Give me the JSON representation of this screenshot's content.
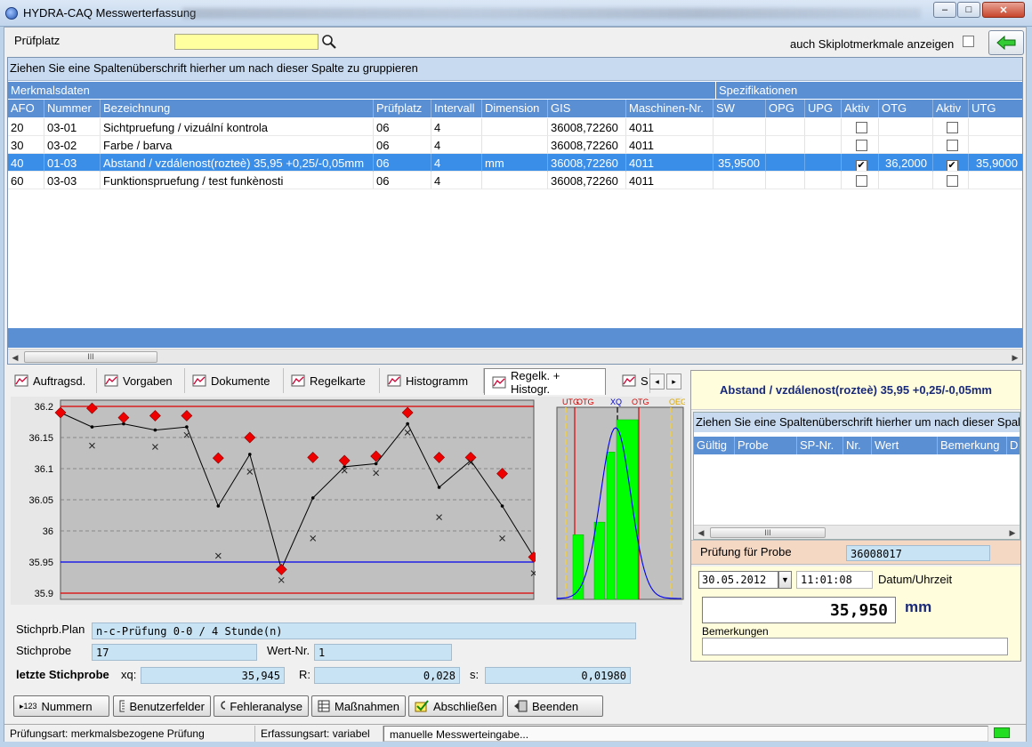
{
  "window": {
    "title": "HYDRA-CAQ Messwerterfassung",
    "min_label": "–",
    "max_label": "□",
    "close_label": "✕"
  },
  "top": {
    "pruefplatz_label": "Prüfplatz",
    "pruefplatz_value": "",
    "skiplot_label": "auch Skiplotmerkmale anzeigen"
  },
  "grid": {
    "group_hint": "Ziehen Sie eine Spaltenüberschrift hierher um nach dieser Spalte zu gruppieren",
    "band_left": "Merkmalsdaten",
    "band_right": "Spezifikationen",
    "columns": [
      "AFO",
      "Nummer",
      "Bezeichnung",
      "Prüfplatz",
      "Intervall",
      "Dimension",
      "GIS",
      "Maschinen-Nr.",
      "SW",
      "OPG",
      "UPG",
      "Aktiv",
      "OTG",
      "Aktiv",
      "UTG"
    ],
    "rows": [
      {
        "afo": "20",
        "nummer": "03-01",
        "bez": "Sichtpruefung / vizuální kontrola",
        "pp": "06",
        "int": "4",
        "dim": "",
        "gis": "36008,72260",
        "masch": "4011",
        "sw": "",
        "opg": "",
        "upg": "",
        "aktiv1": false,
        "otg": "",
        "aktiv2": false,
        "utg": "",
        "selected": false
      },
      {
        "afo": "30",
        "nummer": "03-02",
        "bez": "Farbe / barva",
        "pp": "06",
        "int": "4",
        "dim": "",
        "gis": "36008,72260",
        "masch": "4011",
        "sw": "",
        "opg": "",
        "upg": "",
        "aktiv1": false,
        "otg": "",
        "aktiv2": false,
        "utg": "",
        "selected": false
      },
      {
        "afo": "40",
        "nummer": "01-03",
        "bez": "Abstand / vzdálenost(rozteè) 35,95 +0,25/-0,05mm",
        "pp": "06",
        "int": "4",
        "dim": "mm",
        "gis": "36008,72260",
        "masch": "4011",
        "sw": "35,9500",
        "opg": "",
        "upg": "",
        "aktiv1": true,
        "otg": "36,2000",
        "aktiv2": true,
        "utg": "35,9000",
        "selected": true
      },
      {
        "afo": "60",
        "nummer": "03-03",
        "bez": "Funktionspruefung / test funkènosti",
        "pp": "06",
        "int": "4",
        "dim": "",
        "gis": "36008,72260",
        "masch": "4011",
        "sw": "",
        "opg": "",
        "upg": "",
        "aktiv1": false,
        "otg": "",
        "aktiv2": false,
        "utg": "",
        "selected": false
      }
    ],
    "scroll_grip": "III"
  },
  "tabs": [
    {
      "label": "Auftragsd.",
      "icon": "clipboard-icon"
    },
    {
      "label": "Vorgaben",
      "icon": "chart-settings-icon"
    },
    {
      "label": "Dokumente",
      "icon": "microscope-icon"
    },
    {
      "label": "Regelkarte",
      "icon": "control-chart-icon"
    },
    {
      "label": "Histogramm",
      "icon": "histogram-icon"
    },
    {
      "label": "Regelk. + Histogr.",
      "icon": "control-histogram-icon"
    },
    {
      "label": "S",
      "icon": "bar-chart-icon"
    }
  ],
  "chart_data": {
    "type": "line",
    "y_ticks": [
      "36.2",
      "36.15",
      "36.1",
      "36.05",
      "36",
      "35.95",
      "35.9"
    ],
    "ylim": [
      35.89,
      36.21
    ],
    "limits": {
      "upper_red": 36.2,
      "lower_red": 35.9,
      "blue": 35.95
    },
    "series": [
      {
        "values": [
          36.19,
          36.167,
          36.172,
          36.162,
          36.167,
          36.04,
          36.123,
          35.939,
          36.053,
          36.103,
          36.108,
          36.172,
          36.07,
          36.113,
          36.04,
          35.958
        ]
      },
      {
        "values": [
          36.19,
          36.197,
          36.182,
          36.185,
          36.185,
          36.117,
          36.15,
          35.938,
          36.118,
          36.113,
          36.12,
          36.19,
          36.118,
          36.118,
          36.092,
          35.958
        ]
      },
      {
        "values": [
          null,
          36.137,
          null,
          36.135,
          36.154,
          35.96,
          36.095,
          35.921,
          35.988,
          36.097,
          36.093,
          36.158,
          36.022,
          36.11,
          35.988,
          35.932
        ]
      }
    ],
    "histogram": {
      "labels": [
        "UTG",
        "OTG",
        "XQ",
        "OTG",
        "OEG"
      ],
      "values": [
        0.36,
        0.43,
        0.82,
        1.0
      ]
    }
  },
  "plan": {
    "stichprb_plan_label": "Stichprb.Plan",
    "stichprb_plan_value": "n-c-Prüfung 0-0 / 4 Stunde(n)",
    "stichprobe_label": "Stichprobe",
    "stichprobe_value": "17",
    "wertnr_label": "Wert-Nr.",
    "wertnr_value": "1",
    "letzte_label": "letzte Stichprobe",
    "xq_label": "xq:",
    "xq_value": "35,945",
    "r_label": "R:",
    "r_value": "0,028",
    "s_label": "s:",
    "s_value": "0,01980"
  },
  "buttons": {
    "nummern": "Nummern",
    "nummern_prefix": "▸123",
    "benutzerfelder": "Benutzerfelder",
    "fehleranalyse": "Fehleranalyse",
    "massnahmen": "Maßnahmen",
    "abschliessen": "Abschließen",
    "beenden": "Beenden"
  },
  "status": {
    "pruefungsart": "Prüfungsart: merkmalsbezogene Prüfung",
    "erfassungsart": "Erfassungsart: variabel",
    "mode": "manuelle Messwerteingabe...",
    "led_color": "#22dd22"
  },
  "right": {
    "title": "Abstand / vzdálenost(rozteè) 35,95 +0,25/-0,05mm",
    "hint": "Ziehen Sie eine Spaltenüberschrift hierher um nach dieser Spalte",
    "columns": [
      "Gültig",
      "Probe",
      "SP-Nr.",
      "Nr.",
      "Wert",
      "Bemerkung",
      "D"
    ],
    "probe_label": "Prüfung für Probe",
    "probe_value": "36008017",
    "date": "30.05.2012",
    "time": "11:01:08",
    "datetime_label": "Datum/Uhrzeit",
    "value": "35,950",
    "unit": "mm",
    "remarks_label": "Bemerkungen",
    "remarks_value": "",
    "scroll_grip": "III"
  },
  "colors": {
    "header_blue": "#5b8fd3",
    "selection_blue": "#3b8ee8",
    "input_yellow": "#ffffa0",
    "readonly_blue": "#c8e3f4",
    "limit_red": "#dd0000",
    "limit_blue": "#0000ee",
    "histo_green": "#00ff00"
  }
}
